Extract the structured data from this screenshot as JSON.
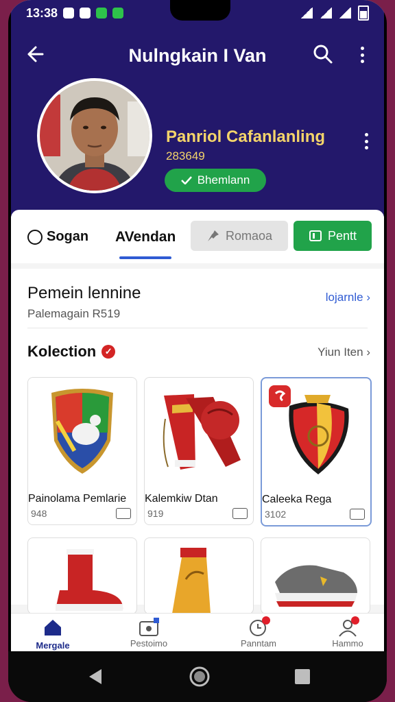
{
  "status_bar": {
    "time": "13:38"
  },
  "app_bar": {
    "title": "Nulngkain I Van"
  },
  "profile": {
    "name": "Panriol Cafanlanling",
    "id_number": "283649",
    "verified_label": "Bhemlann"
  },
  "tabs": {
    "tab1": "Sogan",
    "tab2": "AVendan",
    "grey_button": "Romaoa",
    "green_button": "Pentt"
  },
  "section": {
    "title": "Pemein lennine",
    "subtitle": "Palemagain R519",
    "link": "lojarnle"
  },
  "collection": {
    "title": "Kolection",
    "link": "Yiun Iten",
    "items": [
      {
        "name": "Painolama Pemlarie",
        "price": "948"
      },
      {
        "name": "Kalemkiw Dtan",
        "price": "919"
      },
      {
        "name": "Caleeka Rega",
        "price": "3102"
      }
    ]
  },
  "bottom_nav": [
    {
      "label": "Mergale"
    },
    {
      "label": "Pestoimo"
    },
    {
      "label": "Panntam"
    },
    {
      "label": "Hammo"
    }
  ],
  "colors": {
    "header": "#23186b",
    "accent_green": "#21a34a",
    "accent_blue": "#2f5bd3",
    "name_gold": "#f4d46a"
  }
}
